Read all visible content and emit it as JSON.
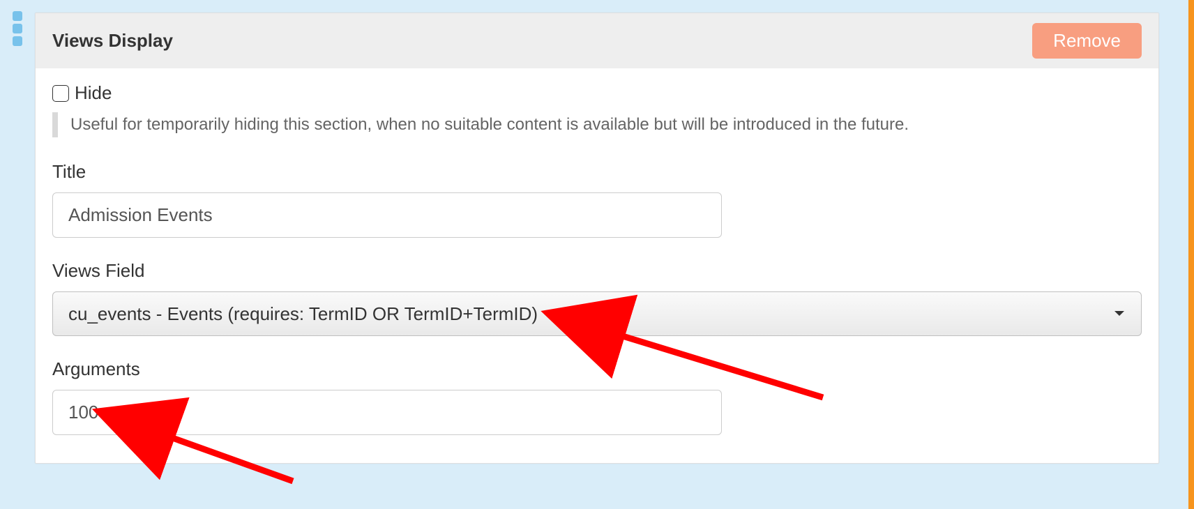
{
  "panel": {
    "header_title": "Views Display",
    "remove_label": "Remove"
  },
  "hide": {
    "label": "Hide",
    "checked": false,
    "hint": "Useful for temporarily hiding this section, when no suitable content is available but will be introduced in the future."
  },
  "title_field": {
    "label": "Title",
    "value": "Admission Events"
  },
  "views_field": {
    "label": "Views Field",
    "selected": "cu_events - Events (requires: TermID OR TermID+TermID)"
  },
  "arguments": {
    "label": "Arguments",
    "value": "100"
  },
  "colors": {
    "accent_orange": "#f7941d",
    "remove_button": "#f89e80",
    "page_bg": "#d9edf9",
    "annotation_red": "#ff0000"
  }
}
